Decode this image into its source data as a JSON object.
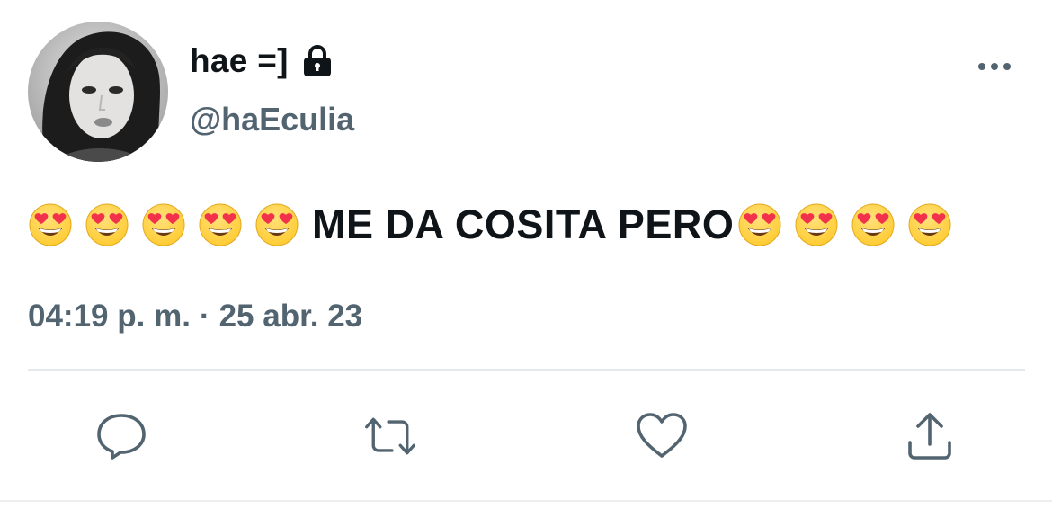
{
  "user": {
    "display_name": "hae =]",
    "handle": "@haEculia",
    "protected_icon": "lock-icon",
    "avatar": "profile-photo"
  },
  "tweet": {
    "emoji_before_count": 5,
    "text": "ME DA COSITA PERO",
    "emoji_after_count": 4,
    "emoji": "smiling-face-with-heart-eyes",
    "time": "04:19 p. m.",
    "separator": "·",
    "date": "25 abr. 23"
  },
  "actions": {
    "reply_icon": "reply-icon",
    "retweet_icon": "retweet-icon",
    "like_icon": "heart-icon",
    "share_icon": "share-icon",
    "more_icon": "more-icon"
  },
  "colors": {
    "text_primary": "#0f1419",
    "text_secondary": "#536471",
    "divider": "#e6e9ec",
    "emoji_face": "#ffcc33",
    "emoji_heart": "#f2314b"
  }
}
